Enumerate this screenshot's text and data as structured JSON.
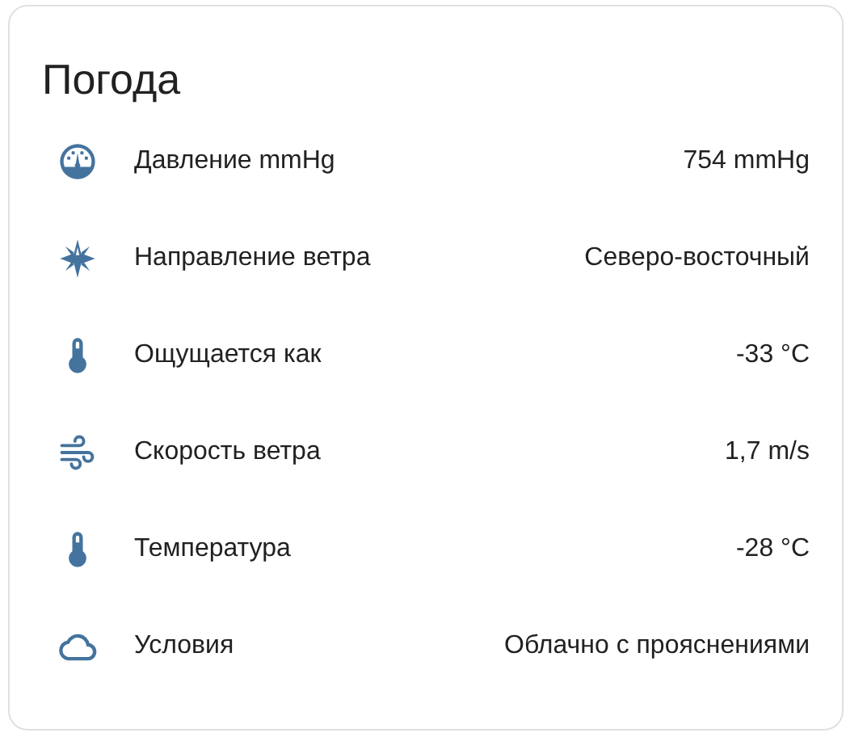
{
  "card": {
    "title": "Погода",
    "rows": [
      {
        "kind": "pressure",
        "label": "Давление mmHg",
        "value": "754 mmHg"
      },
      {
        "kind": "direction",
        "label": "Направление ветра",
        "value": "Северо-восточный"
      },
      {
        "kind": "temperature",
        "label": "Ощущается как",
        "value": "-33 °C"
      },
      {
        "kind": "wind",
        "label": "Скорость ветра",
        "value": "1,7 m/s"
      },
      {
        "kind": "temperature",
        "label": "Температура",
        "value": "-28 °C"
      },
      {
        "kind": "cloud",
        "label": "Условия",
        "value": "Облачно с прояснениями"
      }
    ]
  }
}
